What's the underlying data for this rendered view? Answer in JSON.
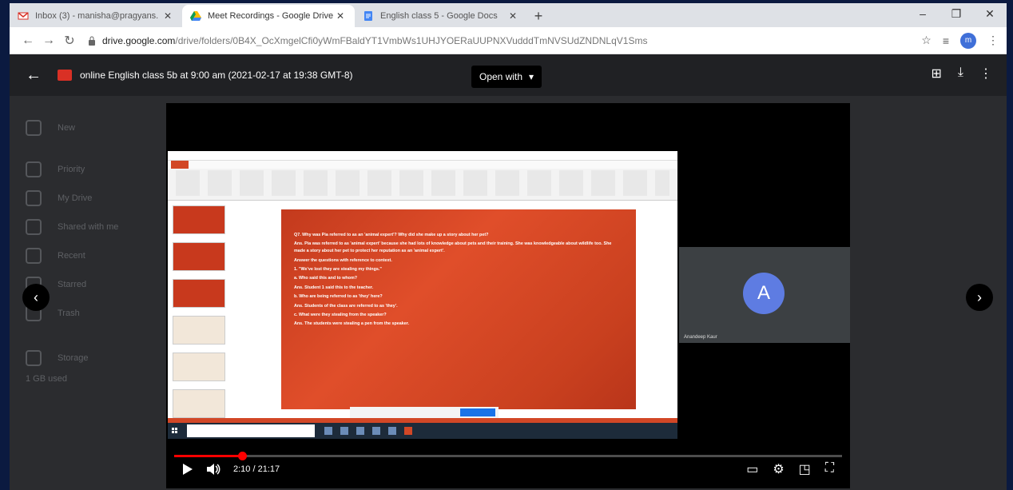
{
  "browser": {
    "tabs": [
      {
        "title": "Inbox (3) - manisha@pragyans.",
        "icon": "gmail-icon",
        "active": false
      },
      {
        "title": "Meet Recordings - Google Drive",
        "icon": "drive-icon",
        "active": true
      },
      {
        "title": "English class 5 - Google Docs",
        "icon": "docs-icon",
        "active": false
      }
    ],
    "new_tab": "+",
    "url_host": "drive.google.com",
    "url_path": "/drive/folders/0B4X_OcXmgelCfi0yWmFBaldYT1VmbWs1UHJYOERaUUPNXVudddTmNVSUdZNDNLqV1Sms",
    "profile_initial": "m"
  },
  "preview": {
    "file_name": "online English class 5b at 9:00 am (2021-02-17 at 19:38 GMT-8)",
    "open_with": "Open with",
    "colors": {
      "accent": "#d93025",
      "progress": "#ff0000",
      "avatar": "#5e7ce2"
    }
  },
  "player": {
    "time": "2:10 / 21:17",
    "progress_fraction": 0.102,
    "participant_initial": "A",
    "participant_name": "Anandeep Kaur"
  },
  "slide": {
    "lines": [
      "Q7. Why was Pia referred to as an 'animal expert'? Why did she make up a story about her pet?",
      "Ans. Pia was referred to as 'animal expert' because she had lots of knowledge about pets and their training. She was knowledgeable about wildlife too. She made a story about her pet to protect her reputation as an 'animal expert'.",
      "Answer the questions with reference to context.",
      "1. \"We've lost they are stealing my things.\"",
      "a. Who said this and to whom?",
      "Ans. Student 1 said this to the teacher.",
      "b. Who are being referred to as 'they' here?",
      "Ans. Students of the class are referred to as 'they'.",
      "c. What were they stealing from the speaker?",
      "Ans. The students were stealing a pen from the speaker."
    ]
  },
  "drive_bg": {
    "items": [
      "New",
      "Priority",
      "My Drive",
      "Shared with me",
      "Recent",
      "Starred",
      "Trash",
      "Storage",
      "1 GB used"
    ]
  }
}
